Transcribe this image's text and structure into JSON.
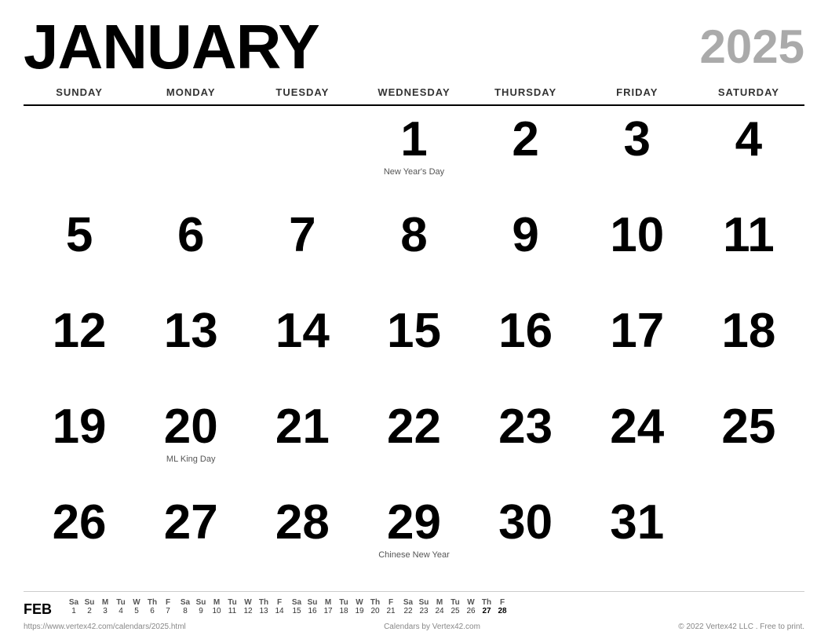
{
  "header": {
    "month": "JANUARY",
    "year": "2025"
  },
  "weekdays": [
    "SUNDAY",
    "MONDAY",
    "TUESDAY",
    "WEDNESDAY",
    "THURSDAY",
    "FRIDAY",
    "SATURDAY"
  ],
  "days": [
    {
      "num": "",
      "holiday": "",
      "col": 1
    },
    {
      "num": "",
      "holiday": "",
      "col": 2
    },
    {
      "num": "",
      "holiday": "",
      "col": 3
    },
    {
      "num": "1",
      "holiday": "New Year's Day",
      "col": 4
    },
    {
      "num": "2",
      "holiday": "",
      "col": 5
    },
    {
      "num": "3",
      "holiday": "",
      "col": 6
    },
    {
      "num": "4",
      "holiday": "",
      "col": 7
    },
    {
      "num": "5",
      "holiday": "",
      "col": 1
    },
    {
      "num": "6",
      "holiday": "",
      "col": 2
    },
    {
      "num": "7",
      "holiday": "",
      "col": 3
    },
    {
      "num": "8",
      "holiday": "",
      "col": 4
    },
    {
      "num": "9",
      "holiday": "",
      "col": 5
    },
    {
      "num": "10",
      "holiday": "",
      "col": 6
    },
    {
      "num": "11",
      "holiday": "",
      "col": 7
    },
    {
      "num": "12",
      "holiday": "",
      "col": 1
    },
    {
      "num": "13",
      "holiday": "",
      "col": 2
    },
    {
      "num": "14",
      "holiday": "",
      "col": 3
    },
    {
      "num": "15",
      "holiday": "",
      "col": 4
    },
    {
      "num": "16",
      "holiday": "",
      "col": 5
    },
    {
      "num": "17",
      "holiday": "",
      "col": 6
    },
    {
      "num": "18",
      "holiday": "",
      "col": 7
    },
    {
      "num": "19",
      "holiday": "",
      "col": 1
    },
    {
      "num": "20",
      "holiday": "ML King Day",
      "col": 2
    },
    {
      "num": "21",
      "holiday": "",
      "col": 3
    },
    {
      "num": "22",
      "holiday": "",
      "col": 4
    },
    {
      "num": "23",
      "holiday": "",
      "col": 5
    },
    {
      "num": "24",
      "holiday": "",
      "col": 6
    },
    {
      "num": "25",
      "holiday": "",
      "col": 7
    },
    {
      "num": "26",
      "holiday": "",
      "col": 1
    },
    {
      "num": "27",
      "holiday": "",
      "col": 2
    },
    {
      "num": "28",
      "holiday": "",
      "col": 3
    },
    {
      "num": "29",
      "holiday": "Chinese New Year",
      "col": 4
    },
    {
      "num": "30",
      "holiday": "",
      "col": 5
    },
    {
      "num": "31",
      "holiday": "",
      "col": 6
    },
    {
      "num": "",
      "holiday": "",
      "col": 7
    }
  ],
  "mini_cal": {
    "month_label": "FEB",
    "weeks": [
      {
        "headers": [
          "Sa",
          "Su",
          "M",
          "Tu",
          "W",
          "Th",
          "F"
        ],
        "numbers": [
          "1",
          "2",
          "3",
          "4",
          "5",
          "6",
          "7"
        ]
      },
      {
        "headers": [
          "Sa",
          "Su",
          "M",
          "Tu",
          "W",
          "Th",
          "F"
        ],
        "numbers": [
          "8",
          "9",
          "10",
          "11",
          "12",
          "13",
          "14"
        ]
      },
      {
        "headers": [
          "Sa",
          "Su",
          "M",
          "Tu",
          "W",
          "Th",
          "F"
        ],
        "numbers": [
          "15",
          "16",
          "17",
          "18",
          "19",
          "20",
          "21"
        ]
      },
      {
        "headers": [
          "Sa",
          "Su",
          "M",
          "Tu",
          "W",
          "Th",
          "F"
        ],
        "numbers": [
          "22",
          "23",
          "24",
          "25",
          "26",
          "27",
          "28"
        ],
        "bold": [
          false,
          false,
          false,
          false,
          false,
          true,
          true
        ]
      }
    ]
  },
  "footer": {
    "url": "https://www.vertex42.com/calendars/2025.html",
    "brand": "Calendars by Vertex42.com",
    "copyright": "© 2022 Vertex42 LLC . Free to print."
  }
}
